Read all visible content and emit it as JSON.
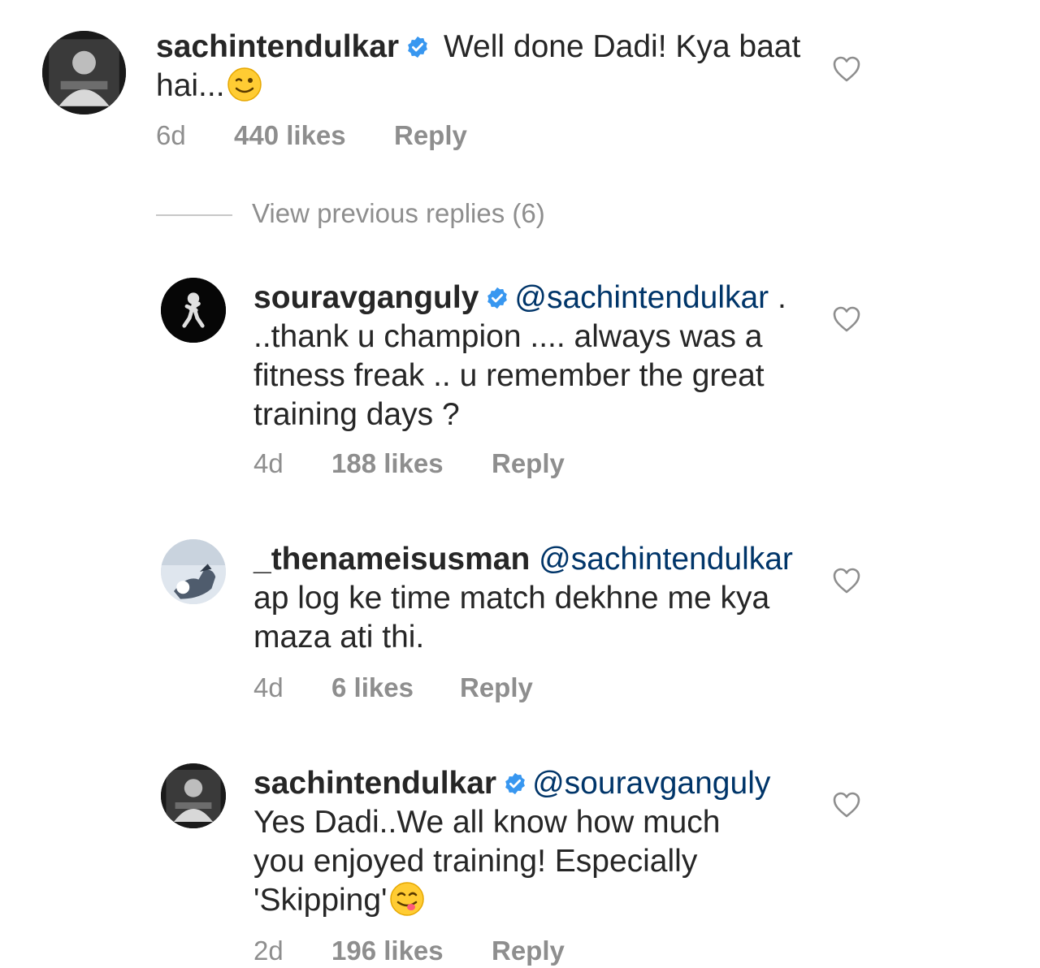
{
  "comments": [
    {
      "username": "sachintendulkar",
      "verified": true,
      "text": "Well done Dadi! Kya baat hai...",
      "emoji": "winking-face",
      "time": "6d",
      "likes": "440 likes",
      "reply": "Reply"
    }
  ],
  "view_previous": "View previous replies (6)",
  "replies": [
    {
      "username": "souravganguly",
      "verified": true,
      "mention": "@sachintendulkar",
      "text_lines": [
        " .",
        "..thank u champion .... always was a",
        "fitness freak .. u remember the great",
        "training days ?"
      ],
      "time": "4d",
      "likes": "188 likes",
      "reply": "Reply"
    },
    {
      "username": "_thenameisusman",
      "verified": false,
      "mention": "@sachintendulkar",
      "text_lines": [
        "ap log ke time match dekhne me kya",
        "maza ati thi."
      ],
      "time": "4d",
      "likes": "6 likes",
      "reply": "Reply"
    },
    {
      "username": "sachintendulkar",
      "verified": true,
      "mention": "@souravganguly",
      "text_lines": [
        "Yes Dadi..We all know how much",
        "you enjoyed training! Especially",
        "'Skipping'"
      ],
      "emoji": "face-savoring-food",
      "time": "2d",
      "likes": "196 likes",
      "reply": "Reply"
    }
  ],
  "colors": {
    "text": "#262626",
    "muted": "#8e8e8e",
    "verified": "#3897f0",
    "mention": "#003569"
  }
}
